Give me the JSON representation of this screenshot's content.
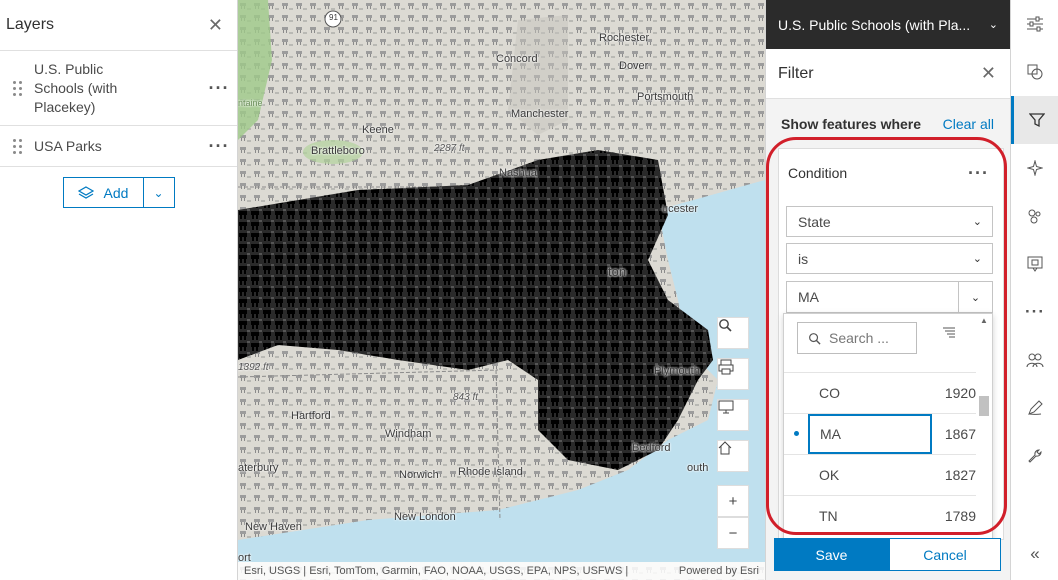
{
  "layers_panel": {
    "title": "Layers",
    "layers": [
      {
        "name": "U.S. Public Schools (with Placekey)"
      },
      {
        "name": "USA Parks"
      }
    ],
    "add_label": "Add"
  },
  "map": {
    "labels": {
      "concord": "Concord",
      "rochester": "Rochester",
      "dover": "Dover",
      "portsmouth": "Portsmouth",
      "manchester": "Manchester",
      "keene": "Keene",
      "brattleboro": "Brattleboro",
      "nashua": "Nashua",
      "gloucester": "ucester",
      "boston": "ton",
      "plymouth": "Plymouth",
      "hartford": "Hartford",
      "windham": "Windham",
      "rhode_island": "Rhode Island",
      "norwich": "Norwich",
      "waterbury": "aterbury",
      "new_haven": "New Haven",
      "new_london": "New London",
      "bedford": "Bedford",
      "louth": "outh",
      "elev_2287": "2287 ft",
      "elev_843": "843 ft",
      "elev_1392": "1392 ft",
      "route_91": "91",
      "fontaine": "ntaine",
      "fort": "ort"
    },
    "attribution": "Esri, USGS | Esri, TomTom, Garmin, FAO, NOAA, USGS, EPA, NPS, USFWS |",
    "powered_by": "Powered by Esri",
    "zoom_in": "+",
    "zoom_out": "−"
  },
  "filter_panel": {
    "layer_selector": "U.S. Public Schools (with Pla...",
    "title": "Filter",
    "show_features": "Show features where",
    "clear_all": "Clear all",
    "condition": {
      "title": "Condition",
      "field": "State",
      "operator": "is",
      "value": "MA"
    },
    "dropdown": {
      "search_placeholder": "Search ...",
      "rows": [
        {
          "code": "CO",
          "count": "1920",
          "selected": false
        },
        {
          "code": "MA",
          "count": "1867",
          "selected": true
        },
        {
          "code": "OK",
          "count": "1827",
          "selected": false
        },
        {
          "code": "TN",
          "count": "1789",
          "selected": false
        }
      ]
    },
    "save_label": "Save",
    "cancel_label": "Cancel"
  },
  "right_toolbar": {
    "buttons": [
      {
        "icon": "properties-icon"
      },
      {
        "icon": "styles-icon"
      },
      {
        "icon": "filter-icon",
        "active": true
      },
      {
        "icon": "effects-icon"
      },
      {
        "icon": "clustering-icon"
      },
      {
        "icon": "popups-icon"
      },
      {
        "icon": "more-icon"
      },
      {
        "icon": "fields-icon"
      },
      {
        "icon": "sketch-icon"
      },
      {
        "icon": "tools-icon"
      }
    ],
    "collapse_label": "«"
  },
  "colors": {
    "accent": "#007ac2",
    "header_dark": "#2b2b2b",
    "highlight_ring": "#d11f2a",
    "water": "#bfe0ee"
  }
}
